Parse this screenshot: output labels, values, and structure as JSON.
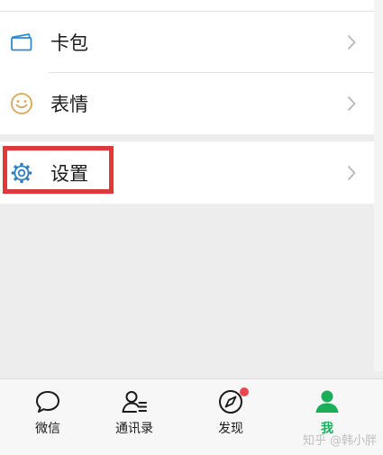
{
  "menu": {
    "card_label": "卡包",
    "sticker_label": "表情",
    "settings_label": "设置"
  },
  "tabs": [
    {
      "label": "微信",
      "icon": "chat-bubble-icon",
      "active": false
    },
    {
      "label": "通讯录",
      "icon": "contacts-icon",
      "active": false
    },
    {
      "label": "发现",
      "icon": "compass-icon",
      "active": false,
      "badge": true
    },
    {
      "label": "我",
      "icon": "person-icon",
      "active": true
    }
  ],
  "watermark": "知乎 @韩小胖",
  "colors": {
    "accent_green": "#1aad5a",
    "card_icon": "#2d8bd0",
    "sticker_icon": "#d8a65a",
    "settings_icon": "#2f7fc1",
    "highlight_red": "#e1393a",
    "badge_red": "#f0454f"
  }
}
